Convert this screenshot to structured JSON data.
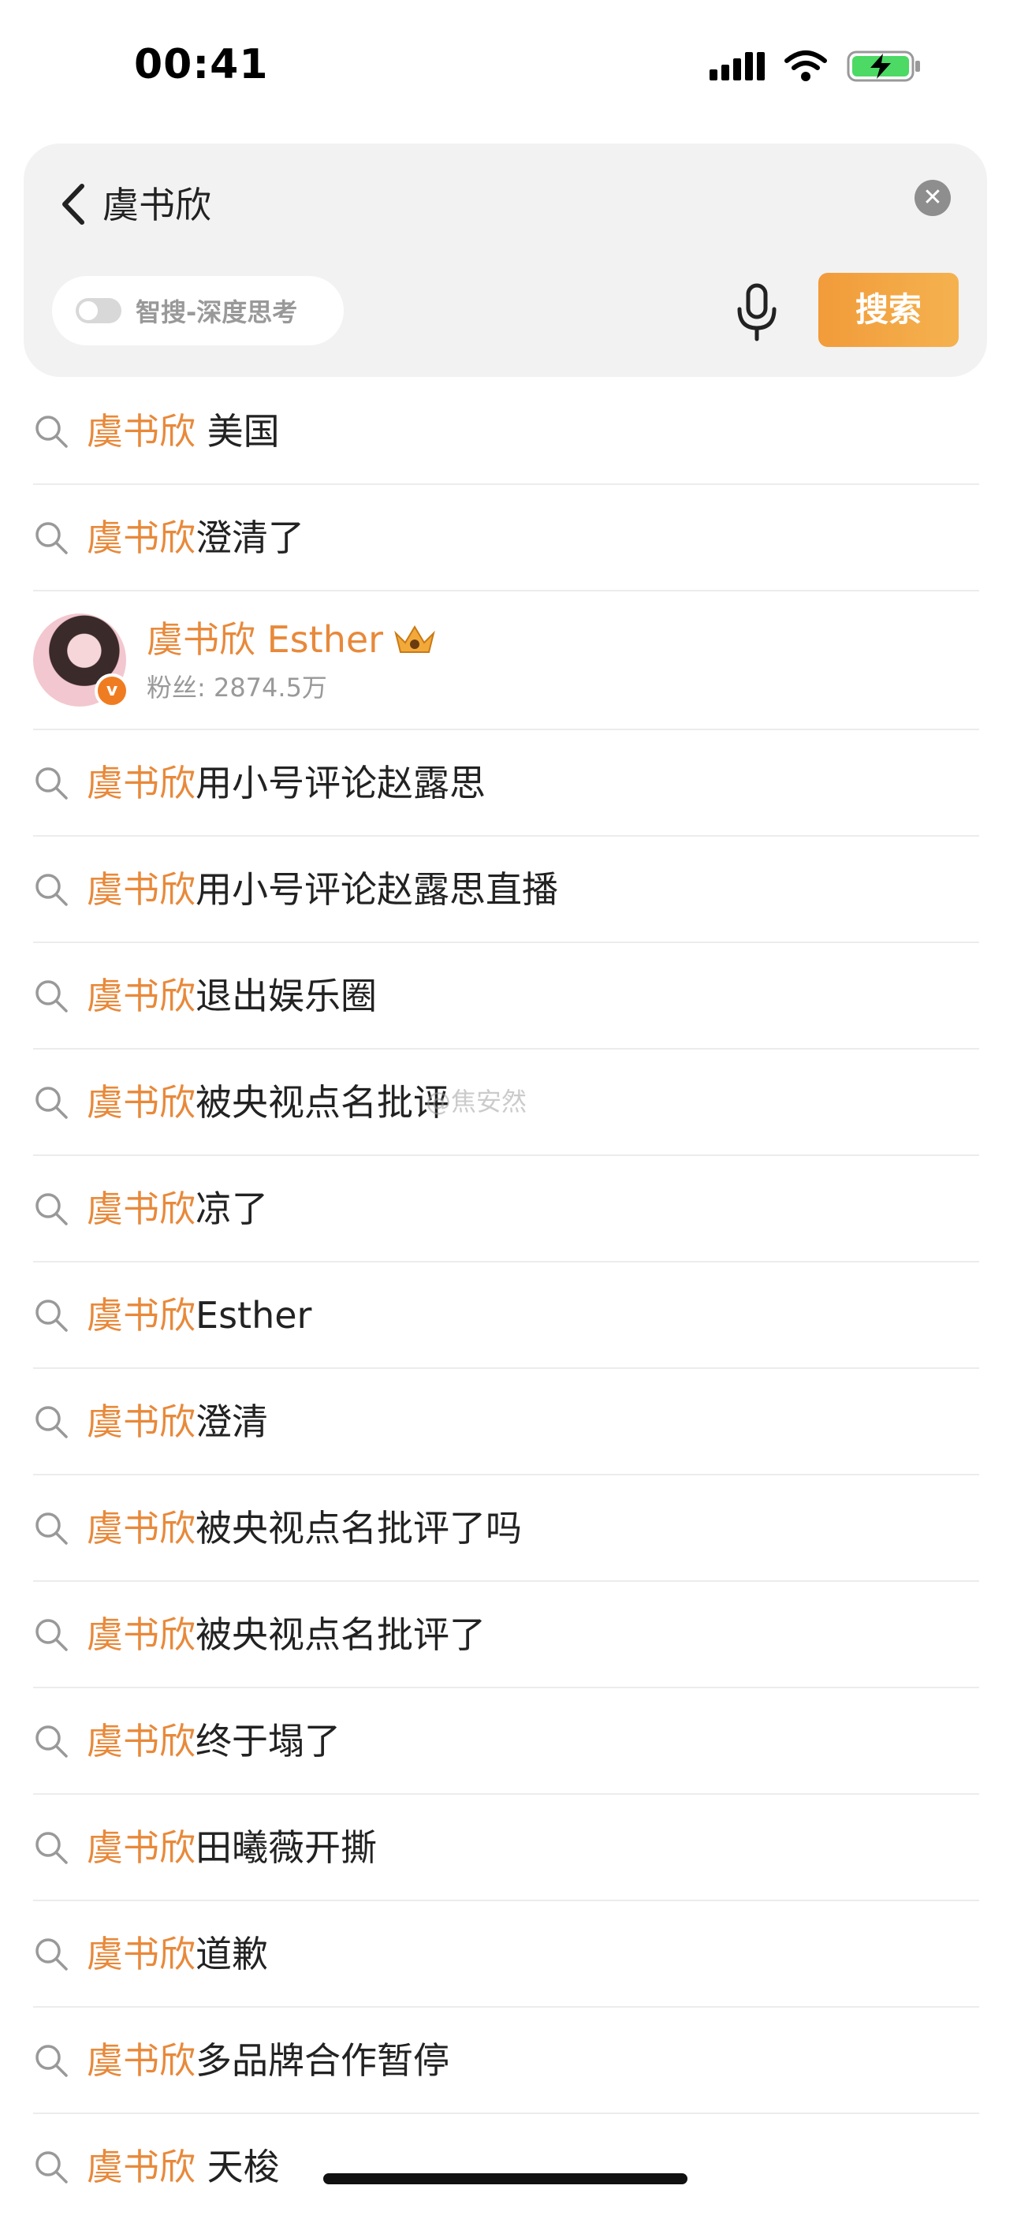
{
  "status_bar": {
    "time": "00:41"
  },
  "search": {
    "query": "虞书欣",
    "deep_search_label": "智搜-深度思考",
    "search_button": "搜索"
  },
  "user_card": {
    "name": "虞书欣",
    "name_suffix": " Esther",
    "fans": "粉丝: 2874.5万"
  },
  "suggestions": [
    {
      "hl": "虞书欣",
      "rest": " 美国"
    },
    {
      "hl": "虞书欣",
      "rest": "澄清了"
    },
    {
      "hl": "虞书欣",
      "rest": "用小号评论赵露思"
    },
    {
      "hl": "虞书欣",
      "rest": "用小号评论赵露思直播"
    },
    {
      "hl": "虞书欣",
      "rest": "退出娱乐圈"
    },
    {
      "hl": "虞书欣",
      "rest": "被央视点名批评"
    },
    {
      "hl": "虞书欣",
      "rest": "凉了"
    },
    {
      "hl": "虞书欣",
      "rest": "Esther"
    },
    {
      "hl": "虞书欣",
      "rest": "澄清"
    },
    {
      "hl": "虞书欣",
      "rest": "被央视点名批评了吗"
    },
    {
      "hl": "虞书欣",
      "rest": "被央视点名批评了"
    },
    {
      "hl": "虞书欣",
      "rest": "终于塌了"
    },
    {
      "hl": "虞书欣",
      "rest": "田曦薇开撕"
    },
    {
      "hl": "虞书欣",
      "rest": "道歉"
    },
    {
      "hl": "虞书欣",
      "rest": "多品牌合作暂停"
    },
    {
      "hl": "虞书欣",
      "rest": " 天梭"
    }
  ],
  "watermark": "@焦安然",
  "colors": {
    "highlight": "#e8893a",
    "search_button": "#f29b3a"
  }
}
